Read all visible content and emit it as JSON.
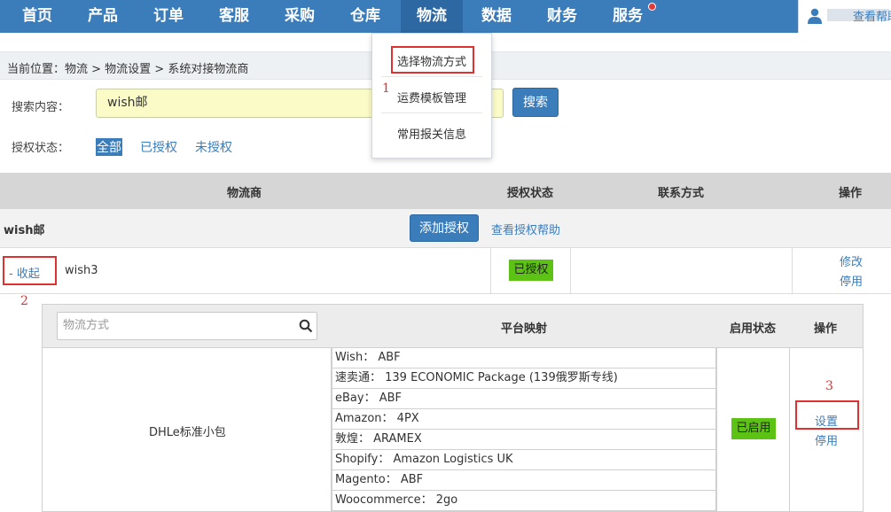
{
  "nav": {
    "items": [
      "首页",
      "产品",
      "订单",
      "客服",
      "采购",
      "仓库",
      "物流",
      "数据",
      "财务",
      "服务"
    ],
    "active_index": 6,
    "notification_dot_color": "#e03b3b"
  },
  "logistics_menu": {
    "items": [
      "选择物流方式",
      "运费模板管理",
      "常用报关信息"
    ]
  },
  "breadcrumb": "当前位置：物流 > 物流设置 > 系统对接物流商",
  "help_link": "查看帮助",
  "search": {
    "label": "搜索内容：",
    "value": "wish邮",
    "button": "搜索"
  },
  "auth_filter": {
    "label": "授权状态：",
    "options": [
      "全部",
      "已授权",
      "未授权"
    ],
    "selected_index": 0
  },
  "table": {
    "headers": [
      "物流商",
      "授权状态",
      "联系方式",
      "操作"
    ],
    "group": {
      "name": "wish邮",
      "add_button": "添加授权",
      "help_link": "查看授权帮助"
    },
    "provider": {
      "toggle": "- 收起",
      "name": "wish3",
      "status": "已授权",
      "actions": [
        "修改",
        "停用"
      ]
    }
  },
  "inner_table": {
    "search_placeholder": "物流方式",
    "headers": [
      "平台映射",
      "启用状态",
      "操作"
    ],
    "method": {
      "name": "DHLe标准小包",
      "mappings": [
        "Wish： ABF",
        "速卖通： 139 ECONOMIC Package (139俄罗斯专线)",
        "eBay： ABF",
        "Amazon： 4PX",
        "敦煌： ARAMEX",
        "Shopify： Amazon Logistics UK",
        "Magento： ABF",
        "Woocommerce： 2go"
      ],
      "status": "已启用",
      "actions": [
        "设置",
        "停用"
      ]
    }
  },
  "annotations": [
    "1",
    "2",
    "3"
  ],
  "colors": {
    "nav_bg": "#3b7dbb",
    "badge_green": "#5cc214",
    "highlight_red": "#e03131"
  }
}
